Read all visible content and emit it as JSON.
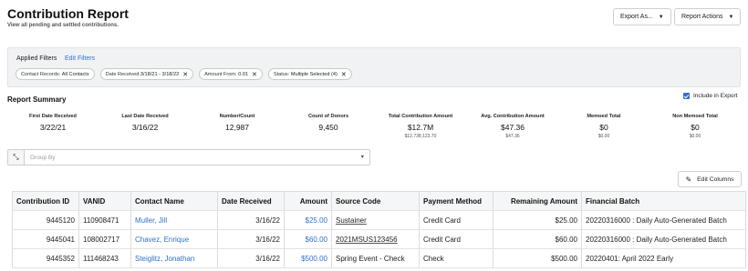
{
  "header": {
    "title": "Contribution Report",
    "subtitle": "View all pending and settled contributions.",
    "export_label": "Export As...",
    "actions_label": "Report Actions"
  },
  "filters": {
    "label": "Applied Filters",
    "edit_label": "Edit Filters",
    "chips": [
      {
        "key": "Contact Records:",
        "value": "All Contacts",
        "removable": false
      },
      {
        "key": "Date Received:",
        "value": "3/18/21 - 3/18/22",
        "removable": true
      },
      {
        "key": "Amount From:",
        "value": "0.01",
        "removable": true
      },
      {
        "key": "Status:",
        "value": "Multiple Selected (4)",
        "removable": true
      }
    ]
  },
  "summary": {
    "title": "Report Summary",
    "include_label": "Include in Export",
    "stats": [
      {
        "label": "First Date Received",
        "value": "3/22/21",
        "sub": ""
      },
      {
        "label": "Last Date Received",
        "value": "3/16/22",
        "sub": ""
      },
      {
        "label": "Number/Count",
        "value": "12,987",
        "sub": ""
      },
      {
        "label": "Count of Donors",
        "value": "9,450",
        "sub": ""
      },
      {
        "label": "Total Contribution Amount",
        "value": "$12.7M",
        "sub": "$12,738,123.70"
      },
      {
        "label": "Avg. Contribution Amount",
        "value": "$47.36",
        "sub": "$47.36"
      },
      {
        "label": "Memoed Total",
        "value": "$0",
        "sub": "$0.00"
      },
      {
        "label": "Non Memoed Total",
        "value": "$0",
        "sub": "$0.00"
      }
    ]
  },
  "groupby": {
    "placeholder": "Group By"
  },
  "edit_columns_label": "Edit Columns",
  "table": {
    "headers": [
      "Contribution ID",
      "VANID",
      "Contact Name",
      "Date Received",
      "Amount",
      "Source Code",
      "Payment Method",
      "Remaining Amount",
      "Financial Batch"
    ],
    "rows": [
      [
        "9445120",
        "110908471",
        "Muller, Jill",
        "3/16/22",
        "$25.00",
        "Sustainer",
        "Credit Card",
        "$25.00",
        "20220316000 : Daily Auto-Generated Batch"
      ],
      [
        "9445041",
        "108002717",
        "Chavez, Enrique",
        "3/16/22",
        "$60.00",
        "2021MSUS123456",
        "Credit Card",
        "$60.00",
        "20220316000 : Daily Auto-Generated Batch"
      ],
      [
        "9445352",
        "111468243",
        "Steiglitz, Jonathan",
        "3/16/22",
        "$500.00",
        "Spring Event - Check",
        "Check",
        "$500.00",
        "20220401: April 2022 Early"
      ]
    ]
  },
  "colors": {
    "link": "#2f73c9",
    "checkbox": "#2f6fd6",
    "filter_bg": "#f1f2f4"
  }
}
